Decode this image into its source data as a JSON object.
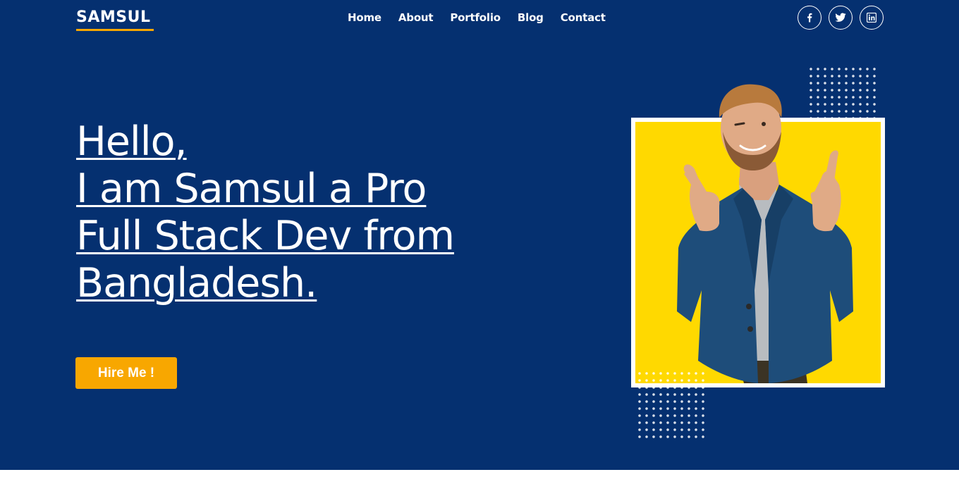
{
  "brand": {
    "logo_text": "SAMSUL",
    "accent_color": "#f8a700",
    "hero_background": "#053070",
    "photo_background": "#ffd900"
  },
  "nav": {
    "items": [
      {
        "label": "Home"
      },
      {
        "label": "About"
      },
      {
        "label": "Portfolio"
      },
      {
        "label": "Blog"
      },
      {
        "label": "Contact"
      }
    ]
  },
  "social": {
    "icons": [
      "facebook-icon",
      "twitter-icon",
      "linkedin-icon"
    ]
  },
  "hero": {
    "headline_lines": [
      "Hello,",
      "I am Samsul a Pro",
      "Full Stack Dev from",
      "Bangladesh."
    ],
    "cta_label": "Hire Me !"
  }
}
